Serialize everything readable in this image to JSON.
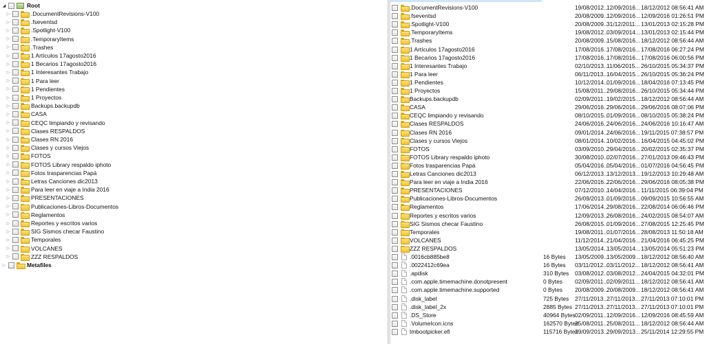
{
  "left_tree": {
    "root_label": "Root",
    "metafiles_label": "Metafiles",
    "items": [
      ".DocumentRevisions-V100",
      ".fseventsd",
      ".Spotlight-V100",
      ".TemporaryItems",
      ".Trashes",
      "1 Artículos 17agosto2016",
      "1 Becarios 17agosto2016",
      "1 Interesantes Trabajo",
      "1 Para leer",
      "1 Pendientes",
      "1 Proyectos",
      "Backups.backupdb",
      "CASA",
      "CEQC limpiando y revisando",
      "Clases RESPALDOS",
      "Clases RN 2016",
      "Clases y cursos Viejos",
      "FOTOS",
      "FOTOS Library respaldo iphoto",
      "Fotos trasparencias Papá",
      "Letras Canciones dic2013",
      "Para leer en viaje a India 2016",
      "PRESENTACIONES",
      "Publicaciones-Libros-Documentos",
      "Reglamentos",
      "Reportes y escritos varios",
      "SIG Sismos checar Faustino",
      "Temporales",
      "VOLCANES",
      "ZZZ RESPALDOS"
    ]
  },
  "right_list": {
    "rows": [
      {
        "type": "folder",
        "name": ".DocumentRevisions-V100",
        "size": "",
        "c1": "19/08/2012...",
        "c2": "12/09/2016...",
        "c3": "18/12/2012 08:56:41 AM"
      },
      {
        "type": "folder",
        "name": ".fseventsd",
        "size": "",
        "c1": "20/08/2009...",
        "c2": "12/09/2016...",
        "c3": "12/09/2016 01:26:51 PM"
      },
      {
        "type": "folder",
        "name": ".Spotlight-V100",
        "size": "",
        "c1": "20/08/2009...",
        "c2": "31/12/2011...",
        "c3": "13/01/2013 02:15:28 PM"
      },
      {
        "type": "folder",
        "name": ".TemporaryItems",
        "size": "",
        "c1": "19/08/2012...",
        "c2": "03/09/2014...",
        "c3": "13/01/2013 02:15:44 PM"
      },
      {
        "type": "folder",
        "name": ".Trashes",
        "size": "",
        "c1": "20/08/2009...",
        "c2": "15/08/2016...",
        "c3": "18/12/2012 08:56:44 AM"
      },
      {
        "type": "folder",
        "name": "1 Artículos 17agosto2016",
        "size": "",
        "c1": "17/08/2016...",
        "c2": "17/08/2016...",
        "c3": "17/08/2016 06:27:24 PM"
      },
      {
        "type": "folder",
        "name": "1 Becarios 17agosto2016",
        "size": "",
        "c1": "17/08/2016...",
        "c2": "17/08/2016...",
        "c3": "17/08/2016 06:00:56 PM"
      },
      {
        "type": "folder",
        "name": "1 Interesantes Trabajo",
        "size": "",
        "c1": "02/10/2013...",
        "c2": "11/06/2015...",
        "c3": "26/10/2015 05:34:37 PM"
      },
      {
        "type": "folder",
        "name": "1 Para leer",
        "size": "",
        "c1": "06/11/2013...",
        "c2": "16/04/2015...",
        "c3": "26/10/2015 05:36:24 PM"
      },
      {
        "type": "folder",
        "name": "1 Pendientes",
        "size": "",
        "c1": "10/12/2014...",
        "c2": "01/09/2016...",
        "c3": "18/04/2016 07:13:45 PM"
      },
      {
        "type": "folder",
        "name": "1 Proyectos",
        "size": "",
        "c1": "15/08/2011...",
        "c2": "29/08/2016...",
        "c3": "26/10/2015 05:34:44 PM"
      },
      {
        "type": "folder",
        "name": "Backups.backupdb",
        "size": "",
        "c1": "02/09/2011...",
        "c2": "19/02/2015...",
        "c3": "18/12/2012 08:56:44 AM"
      },
      {
        "type": "folder",
        "name": "CASA",
        "size": "",
        "c1": "29/06/2016...",
        "c2": "29/06/2016...",
        "c3": "29/06/2016 08:07:06 PM"
      },
      {
        "type": "folder",
        "name": "CEQC limpiando y revisando",
        "size": "",
        "c1": "08/10/2015...",
        "c2": "01/09/2016...",
        "c3": "08/10/2015 05:38:24 PM"
      },
      {
        "type": "folder",
        "name": "Clases RESPALDOS",
        "size": "",
        "c1": "24/06/2016...",
        "c2": "24/06/2016...",
        "c3": "24/06/2016 10:16:47 AM"
      },
      {
        "type": "folder",
        "name": "Clases RN 2016",
        "size": "",
        "c1": "09/01/2014...",
        "c2": "24/06/2016...",
        "c3": "19/11/2015 07:38:57 PM"
      },
      {
        "type": "folder",
        "name": "Clases y cursos Viejos",
        "size": "",
        "c1": "08/01/2014...",
        "c2": "10/02/2016...",
        "c3": "16/04/2015 04:45:02 PM"
      },
      {
        "type": "folder",
        "name": "FOTOS",
        "size": "",
        "c1": "03/09/2010...",
        "c2": "29/04/2016...",
        "c3": "20/02/2015 02:35:37 PM"
      },
      {
        "type": "folder",
        "name": "FOTOS Library respaldo iphoto",
        "size": "",
        "c1": "30/08/2010...",
        "c2": "02/07/2016...",
        "c3": "27/01/2013 09:46:43 PM"
      },
      {
        "type": "folder",
        "name": "Fotos trasparencias Papá",
        "size": "",
        "c1": "05/04/2016...",
        "c2": "05/04/2016...",
        "c3": "01/07/2016 04:56:45 PM"
      },
      {
        "type": "folder",
        "name": "Letras Canciones dic2013",
        "size": "",
        "c1": "06/12/2013...",
        "c2": "13/12/2013...",
        "c3": "19/12/2013 10:29:48 AM"
      },
      {
        "type": "folder",
        "name": "Para leer en viaje a India 2016",
        "size": "",
        "c1": "22/06/2016...",
        "c2": "22/06/2016...",
        "c3": "29/06/2016 08:05:38 PM"
      },
      {
        "type": "folder",
        "name": "PRESENTACIONES",
        "size": "",
        "c1": "07/12/2010...",
        "c2": "14/04/2016...",
        "c3": "11/11/2015 06:39:04 PM"
      },
      {
        "type": "folder",
        "name": "Publicaciones-Libros-Documentos",
        "size": "",
        "c1": "26/09/2013...",
        "c2": "01/09/2016...",
        "c3": "09/09/2015 10:56:55 AM"
      },
      {
        "type": "folder",
        "name": "Reglamentos",
        "size": "",
        "c1": "17/06/2014...",
        "c2": "29/08/2016...",
        "c3": "22/08/2014 06:06:46 PM"
      },
      {
        "type": "folder",
        "name": "Reportes y escritos varios",
        "size": "",
        "c1": "12/09/2013...",
        "c2": "26/08/2016...",
        "c3": "24/02/2015 08:54:07 AM"
      },
      {
        "type": "folder",
        "name": "SIG Sismos checar Faustino",
        "size": "",
        "c1": "26/08/2015...",
        "c2": "01/09/2016...",
        "c3": "27/08/2015 12:25:45 PM"
      },
      {
        "type": "folder",
        "name": "Temporales",
        "size": "",
        "c1": "19/08/2011...",
        "c2": "01/07/2016...",
        "c3": "28/08/2013 11:50:18 AM"
      },
      {
        "type": "folder",
        "name": "VOLCANES",
        "size": "",
        "c1": "11/12/2014...",
        "c2": "21/04/2016...",
        "c3": "21/04/2016 06:45:25 PM"
      },
      {
        "type": "folder",
        "name": "ZZZ RESPALDOS",
        "size": "",
        "c1": "13/05/2014...",
        "c2": "13/05/2014...",
        "c3": "13/05/2014 05:51:23 PM"
      },
      {
        "type": "file",
        "name": ".0016cb885be8",
        "size": "16 Bytes",
        "c1": "13/05/2009...",
        "c2": "13/05/2009...",
        "c3": "18/12/2012 08:56:40 AM"
      },
      {
        "type": "file",
        "name": ".0022412c69ea",
        "size": "16 Bytes",
        "c1": "03/11/2012...",
        "c2": "03/11/2012...",
        "c3": "18/12/2012 08:56:41 AM"
      },
      {
        "type": "file",
        "name": ".apdisk",
        "size": "310 Bytes",
        "c1": "03/08/2012...",
        "c2": "03/08/2012...",
        "c3": "24/04/2015 04:32:01 PM"
      },
      {
        "type": "file",
        "name": ".com.apple.timemachine.donotpresent",
        "size": "0 Bytes",
        "c1": "02/09/2011...",
        "c2": "02/09/2011...",
        "c3": "18/12/2012 08:56:41 AM"
      },
      {
        "type": "file",
        "name": ".com.apple.timemachine.supported",
        "size": "0 Bytes",
        "c1": "20/08/2009...",
        "c2": "20/08/2009...",
        "c3": "18/12/2012 08:56:41 AM"
      },
      {
        "type": "file",
        "name": ".disk_label",
        "size": "725 Bytes",
        "c1": "27/11/2013...",
        "c2": "27/11/2013...",
        "c3": "27/11/2013 07:10:01 PM"
      },
      {
        "type": "file",
        "name": ".disk_label_2x",
        "size": "2885 Bytes",
        "c1": "27/11/2013...",
        "c2": "27/11/2013...",
        "c3": "27/11/2013 07:10:01 PM"
      },
      {
        "type": "file",
        "name": ".DS_Store",
        "size": "40964 Bytes",
        "c1": "02/09/2011...",
        "c2": "12/09/2016...",
        "c3": "12/09/2016 08:45:59 AM"
      },
      {
        "type": "file",
        "name": ".VolumeIcon.icns",
        "size": "162570 Bytes",
        "c1": "25/08/2011...",
        "c2": "25/08/2011...",
        "c3": "18/12/2012 08:56:44 AM"
      },
      {
        "type": "file",
        "name": "tmbootpicker.efi",
        "size": "115716 Bytes",
        "c1": "29/09/2013...",
        "c2": "29/09/2013...",
        "c3": "25/11/2014 12:29:55 PM"
      }
    ]
  }
}
